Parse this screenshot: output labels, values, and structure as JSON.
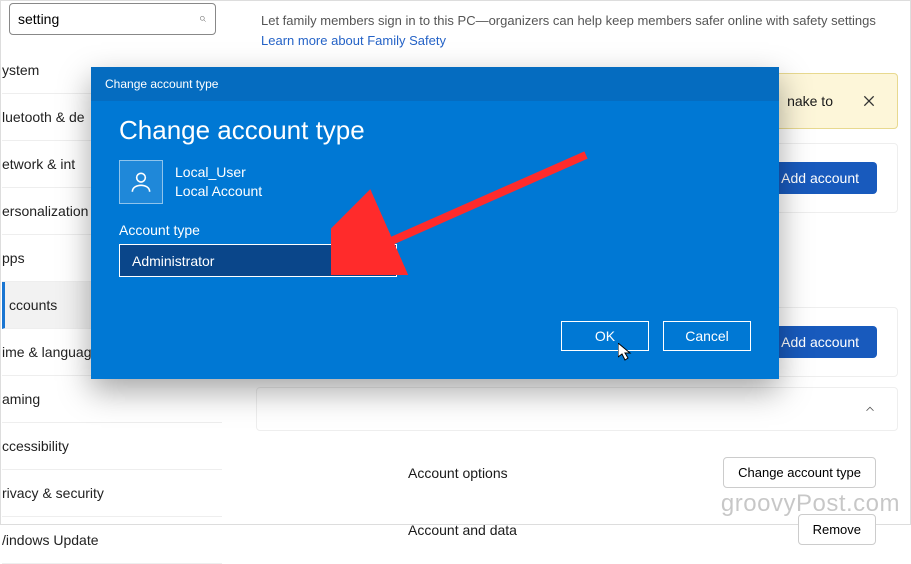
{
  "search": {
    "value": "setting"
  },
  "intro": {
    "text": "Let family members sign in to this PC—organizers can help keep members safer online with safety settings  ",
    "link": "Learn more about Family Safety"
  },
  "sidebar": {
    "items": [
      {
        "label": "ystem"
      },
      {
        "label": "luetooth & de"
      },
      {
        "label": "etwork & int"
      },
      {
        "label": "ersonalization"
      },
      {
        "label": "pps"
      },
      {
        "label": "ccounts"
      },
      {
        "label": "ime & languag"
      },
      {
        "label": "aming"
      },
      {
        "label": "ccessibility"
      },
      {
        "label": "rivacy & security"
      },
      {
        "label": "/indows Update"
      }
    ],
    "selected_index": 5
  },
  "banner": {
    "text_fragment": "nake to"
  },
  "buttons": {
    "add_account": "Add account",
    "change_type": "Change account type",
    "remove": "Remove"
  },
  "sections": {
    "options_label": "Account options",
    "data_label": "Account and data"
  },
  "dialog": {
    "titlebar": "Change account type",
    "heading": "Change account type",
    "user_name": "Local_User",
    "user_sub": "Local Account",
    "account_type_label": "Account type",
    "selected_type": "Administrator",
    "ok": "OK",
    "cancel": "Cancel"
  },
  "watermark": "groovyPost.com"
}
